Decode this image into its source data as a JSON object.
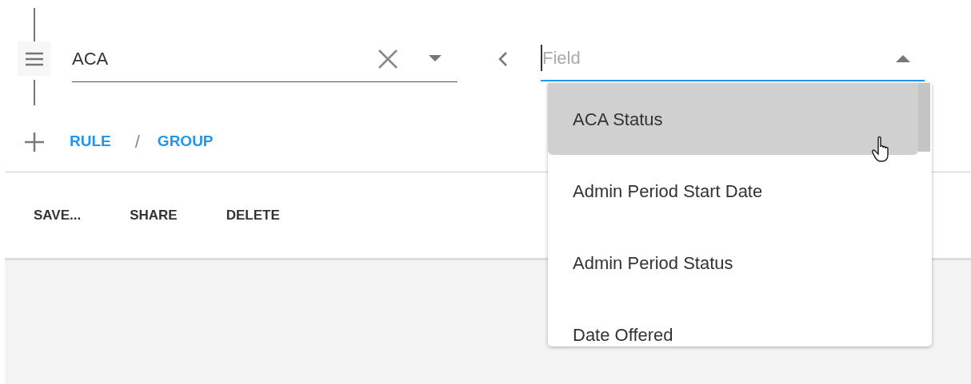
{
  "query": {
    "value": "ACA",
    "field_placeholder": "Field",
    "field_expanded": true
  },
  "add": {
    "rule": "RULE",
    "separator": "/",
    "group": "GROUP"
  },
  "toolbar": [
    "SAVE...",
    "SHARE",
    "DELETE"
  ],
  "field_options": [
    {
      "label": "ACA Status",
      "selected": true
    },
    {
      "label": "Admin Period Start Date",
      "selected": false
    },
    {
      "label": "Admin Period Status",
      "selected": false
    },
    {
      "label": "Date Offered",
      "selected": false
    }
  ]
}
